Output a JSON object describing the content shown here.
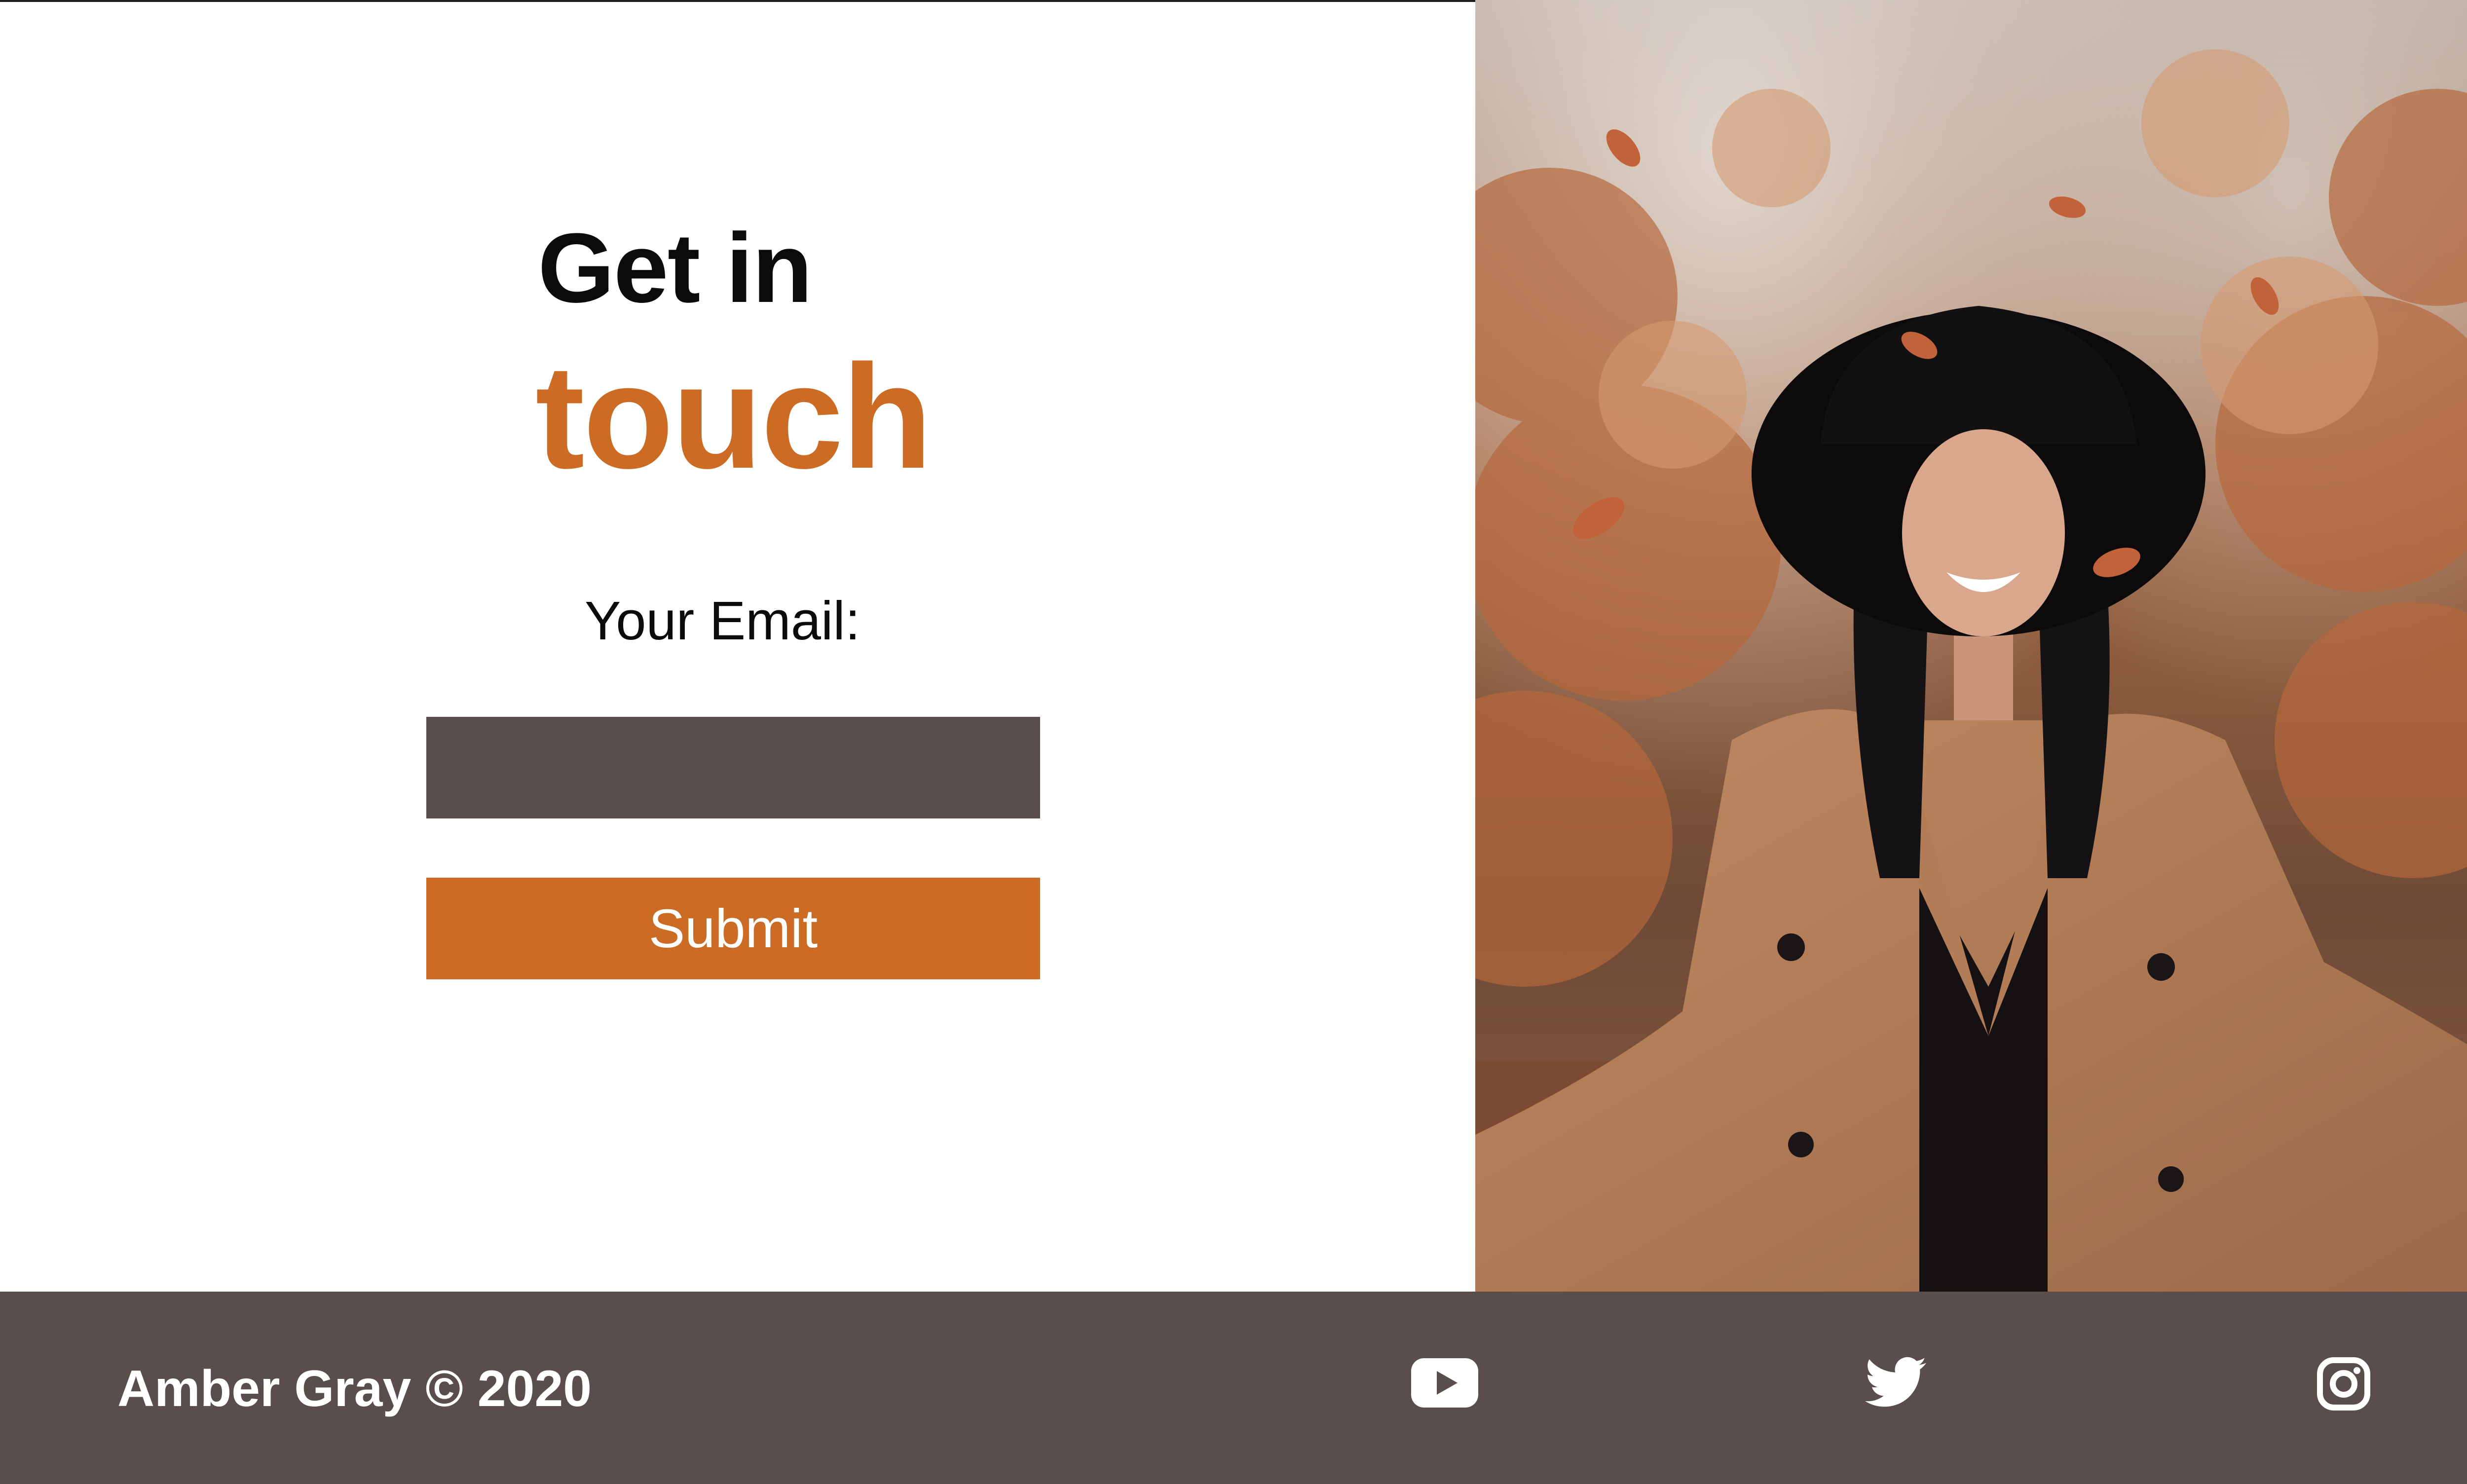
{
  "contact": {
    "title_line1": "Get in",
    "title_line2": "touch",
    "email_label": "Your Email:",
    "email_value": "",
    "submit_label": "Submit"
  },
  "photo": {
    "alt": "Smiling woman in a black hat and camel coat tossing autumn leaves"
  },
  "footer": {
    "copyright": "Amber Gray © 2020",
    "social_icons": [
      "youtube-icon",
      "twitter-icon",
      "instagram-icon"
    ]
  },
  "colors": {
    "accent": "#cc6c24",
    "dark": "#5a4e4c",
    "text": "#0b0b0b"
  }
}
